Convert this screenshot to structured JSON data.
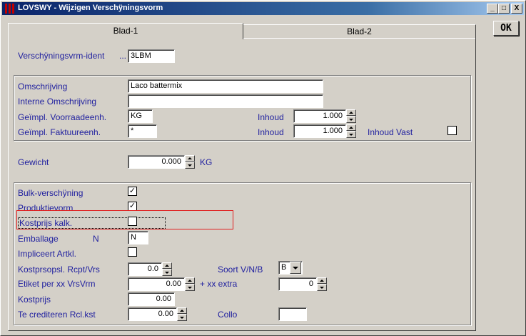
{
  "window": {
    "title": "LOVSWY - Wijzigen Verschÿningsvorm",
    "min_glyph": "_",
    "max_glyph": "□",
    "close_glyph": "X"
  },
  "ok_label": "OK",
  "tabs": [
    {
      "label": "Blad-1"
    },
    {
      "label": "Blad-2"
    }
  ],
  "ident": {
    "label": "Verschÿningsvrm-ident",
    "dots": "...",
    "value": "3LBM"
  },
  "desc": {
    "omschrijving_label": "Omschrijving",
    "omschrijving_value": "Laco battermix",
    "intern_label": "Interne Omschrijving",
    "intern_value": "",
    "voorraad_label": "Geïmpl. Voorraadeenh.",
    "voorraad_value": "KG",
    "faktuur_label": "Geïmpl. Faktuureenh.",
    "faktuur_value": "*",
    "inhoud1_label": "Inhoud",
    "inhoud1_value": "1.000",
    "inhoud2_label": "Inhoud",
    "inhoud2_value": "1.000",
    "inhoud_vast_label": "Inhoud Vast",
    "inhoud_vast_checked": false
  },
  "gewicht": {
    "label": "Gewicht",
    "value": "0.000",
    "unit": "KG"
  },
  "props": {
    "bulk_label": "Bulk-verschÿning",
    "bulk_checked": true,
    "produktie_label": "Produktievorm",
    "produktie_checked": true,
    "kostprijs_kalk_label": "Kostprijs kalk.",
    "kostprijs_kalk_checked": false,
    "emballage_label": "Emballage",
    "emballage_code": "N",
    "emballage_value": "N",
    "impliceert_label": "Impliceert Artkl.",
    "impliceert_checked": false,
    "kostprsopsl_label": "Kostprsopsl. Rcpt/Vrs",
    "kostprsopsl_value": "0.0",
    "soort_label": "Soort V/N/B",
    "soort_value": "B",
    "etiket_label": "Etiket per xx VrsVrm",
    "etiket_value": "0.00",
    "extra_label": "+ xx extra",
    "extra_value": "0",
    "kostprijs_label": "Kostprijs",
    "kostprijs_value": "0.00",
    "crediteren_label": "Te crediteren Rcl.kst",
    "crediteren_value": "0.00",
    "collo_label": "Collo",
    "collo_value": ""
  },
  "check_glyph": "✓"
}
